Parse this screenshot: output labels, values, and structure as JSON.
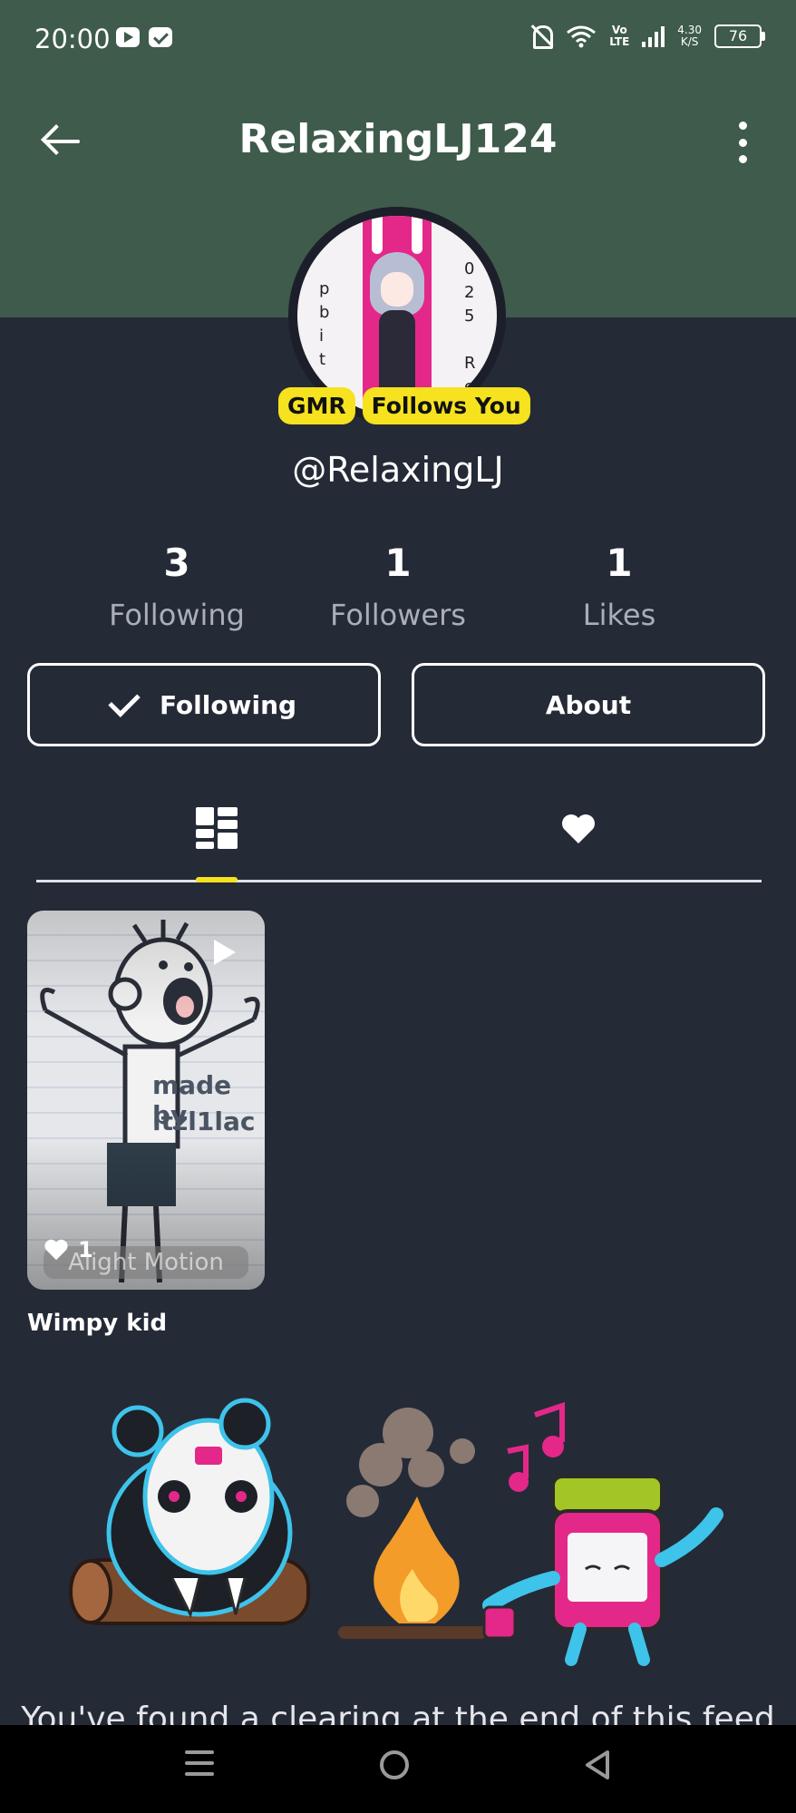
{
  "status_bar": {
    "time": "20:00",
    "network_top": "Vo",
    "network_bottom": "LTE",
    "speed_top": "4.30",
    "speed_bottom": "K/S",
    "battery": "76"
  },
  "header": {
    "title": "RelaxingLJ124"
  },
  "profile": {
    "badges": [
      "GMR",
      "Follows You"
    ],
    "handle": "@RelaxingLJ"
  },
  "stats": [
    {
      "value": "3",
      "label": "Following"
    },
    {
      "value": "1",
      "label": "Followers"
    },
    {
      "value": "1",
      "label": "Likes"
    }
  ],
  "actions": {
    "following_label": "Following",
    "about_label": "About"
  },
  "tabs": {
    "active": "posts",
    "items": [
      "grid-icon",
      "heart-icon"
    ]
  },
  "posts": [
    {
      "title": "Wimpy kid",
      "likes": "1",
      "overlay_text_1": "made by",
      "overlay_text_2": "itzl1lac",
      "watermark": "Alight Motion"
    }
  ],
  "feed_end": {
    "message": "You've found a clearing at the end of this feed"
  },
  "colors": {
    "header_green": "#3f5b4b",
    "background": "#252a37",
    "badge_yellow": "#f6e21e",
    "accent_pink": "#e3288a"
  }
}
